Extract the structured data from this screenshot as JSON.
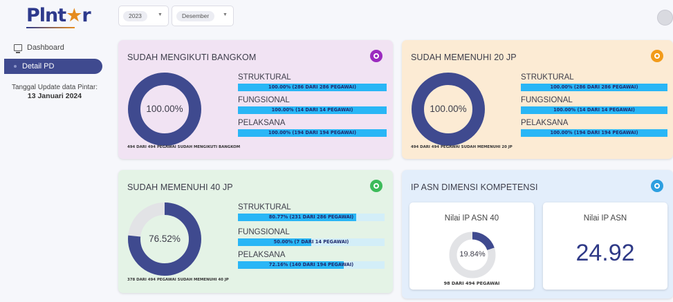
{
  "sidebar": {
    "logo": "PIntar",
    "nav": [
      {
        "label": "Dashboard",
        "icon": "monitor-icon"
      },
      {
        "label": "Detail PD",
        "icon": "dot-icon"
      }
    ],
    "update_label": "Tanggal Update data Pintar:",
    "update_date": "13 Januari 2024"
  },
  "filters": {
    "year": "2023",
    "month": "Desember"
  },
  "colors": {
    "donut_fill": "#3f4a8f",
    "donut_track": "#e2e3e6",
    "bar_fill": "#29b6f6",
    "bar_track": "#d3eef8",
    "purple_badge": "#9b2bbf",
    "orange_badge": "#f29b1a",
    "green_badge": "#3dbb5a",
    "blue_badge": "#2d9fe0"
  },
  "cards": {
    "bangkom": {
      "title": "SUDAH MENGIKUTI BANGKOM",
      "percent_label": "100.00%",
      "percent": 100,
      "footnote": "494 DARI 494 PEGAWAI SUDAH MENGIKUTI BANGKOM",
      "rows": [
        {
          "label": "STRUKTURAL",
          "value_text": "100.00% (286 DARI 286 PEGAWAI)",
          "percent": 100
        },
        {
          "label": "FUNGSIONAL",
          "value_text": "100.00% (14 DARI 14 PEGAWAI)",
          "percent": 100
        },
        {
          "label": "PELAKSANA",
          "value_text": "100.00% (194 DARI 194 PEGAWAI)",
          "percent": 100
        }
      ]
    },
    "jp20": {
      "title": "SUDAH MEMENUHI 20 JP",
      "percent_label": "100.00%",
      "percent": 100,
      "footnote": "494 DARI 494 PEGAWAI SUDAH MEMENUHI 20 JP",
      "rows": [
        {
          "label": "STRUKTURAL",
          "value_text": "100.00% (286 DARI 286 PEGAWAI)",
          "percent": 100
        },
        {
          "label": "FUNGSIONAL",
          "value_text": "100.00% (14 DARI 14 PEGAWAI)",
          "percent": 100
        },
        {
          "label": "PELAKSANA",
          "value_text": "100.00% (194 DARI 194 PEGAWAI)",
          "percent": 100
        }
      ]
    },
    "jp40": {
      "title": "SUDAH MEMENUHI 40 JP",
      "percent_label": "76.52%",
      "percent": 76.52,
      "footnote": "378 DARI 494 PEGAWAI SUDAH MEMENUHI 40 JP",
      "rows": [
        {
          "label": "STRUKTURAL",
          "value_text": "80.77% (231 DARI 286 PEGAWAI)",
          "percent": 80.77
        },
        {
          "label": "FUNGSIONAL",
          "value_text": "50.00% (7 DARI 14 PEGAWAI)",
          "percent": 50
        },
        {
          "label": "PELAKSANA",
          "value_text": "72.16% (140 DARI 194 PEGAWAI)",
          "percent": 72.16
        }
      ]
    },
    "ipasn": {
      "title": "IP ASN DIMENSI KOMPETENSI",
      "nilai40_title": "Nilai IP ASN 40",
      "nilai40_percent_label": "19.84%",
      "nilai40_percent": 19.84,
      "nilai40_footnote": "98 DARI 494 PEGAWAI",
      "nilai_title": "Nilai IP ASN",
      "nilai_value": "24.92"
    }
  }
}
